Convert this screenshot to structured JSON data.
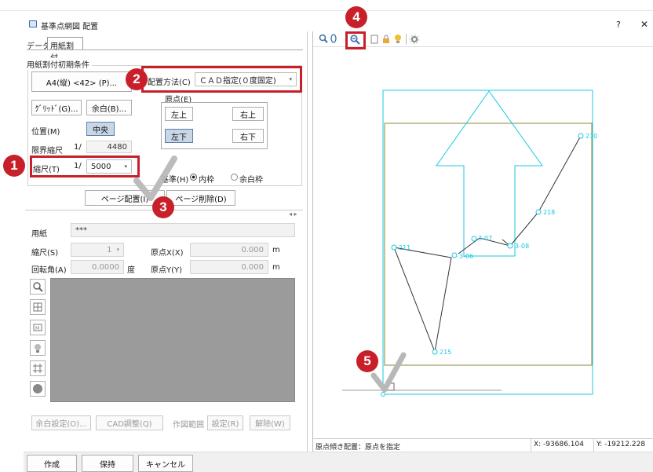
{
  "window": {
    "title": "基準点網図 配置",
    "help": "?",
    "close": "✕"
  },
  "tabs": {
    "data": "データ",
    "paper": "用紙割付"
  },
  "group": {
    "title": "用紙割付初期条件",
    "paper_value": "A4(縦) <42> (P)...",
    "grid_btn": "ｸﾞﾘｯﾄﾞ(G)...",
    "margin_btn": "余白(B)...",
    "position_label": "位置(M)",
    "position_value": "中央",
    "limit_label": "限界縮尺",
    "limit_prefix": "1/",
    "limit_value": "4480",
    "scale_label": "縮尺(T)",
    "scale_prefix": "1/",
    "scale_value": "5000"
  },
  "placement": {
    "label": "配置方法(C)",
    "value": "ＣＡＤ指定(０度固定)",
    "origin_title": "原点(E)",
    "top_left": "左上",
    "top_right": "右上",
    "bottom_left": "左下",
    "bottom_right": "右下",
    "basis_label": "基準(H)",
    "inner": "内枠",
    "margin_frame": "余白枠"
  },
  "page_buttons": {
    "place": "ページ配置(I)",
    "delete": "ページ削除(D)"
  },
  "nav_arrows": "◂ ▸",
  "details": {
    "paper_label": "用紙",
    "paper_value": "***",
    "scale_label": "縮尺(S)",
    "scale_value": "1",
    "rotation_label": "回転角(A)",
    "rotation_value": "0.0000",
    "rotation_unit": "度",
    "origin_x_label": "原点X(X)",
    "origin_x_value": "0.000",
    "origin_y_label": "原点Y(Y)",
    "origin_y_value": "0.000",
    "unit_m": "m"
  },
  "bottom_buttons": {
    "margin_setting": "余白設定(O)...",
    "cad_adjust": "CAD調整(Q)",
    "draw_range": "作図範囲",
    "set": "設定(R)",
    "release": "解除(W)"
  },
  "footer": {
    "create": "作成",
    "hold": "保持",
    "cancel": "キャンセル"
  },
  "status": {
    "message": "原点傾き配置：原点を指定",
    "x": "X: -93686.104",
    "y": "Y: -19212.228"
  },
  "points": [
    {
      "name": "210"
    },
    {
      "name": "218"
    },
    {
      "name": "3-07"
    },
    {
      "name": "3-08"
    },
    {
      "name": "211"
    },
    {
      "name": "3-06"
    },
    {
      "name": "215"
    }
  ],
  "callouts": [
    "1",
    "2",
    "3",
    "4",
    "5"
  ],
  "colors": {
    "accent_red": "#c8202b",
    "cyan": "#18c8e0",
    "olive": "#8a8a3a",
    "panel_gray": "#9b9b9b"
  },
  "icons": [
    "zoom-in-icon",
    "zoom-out-icon",
    "print-icon",
    "light-bulb-icon",
    "grid-icon",
    "circle-icon",
    "settings-icon"
  ]
}
